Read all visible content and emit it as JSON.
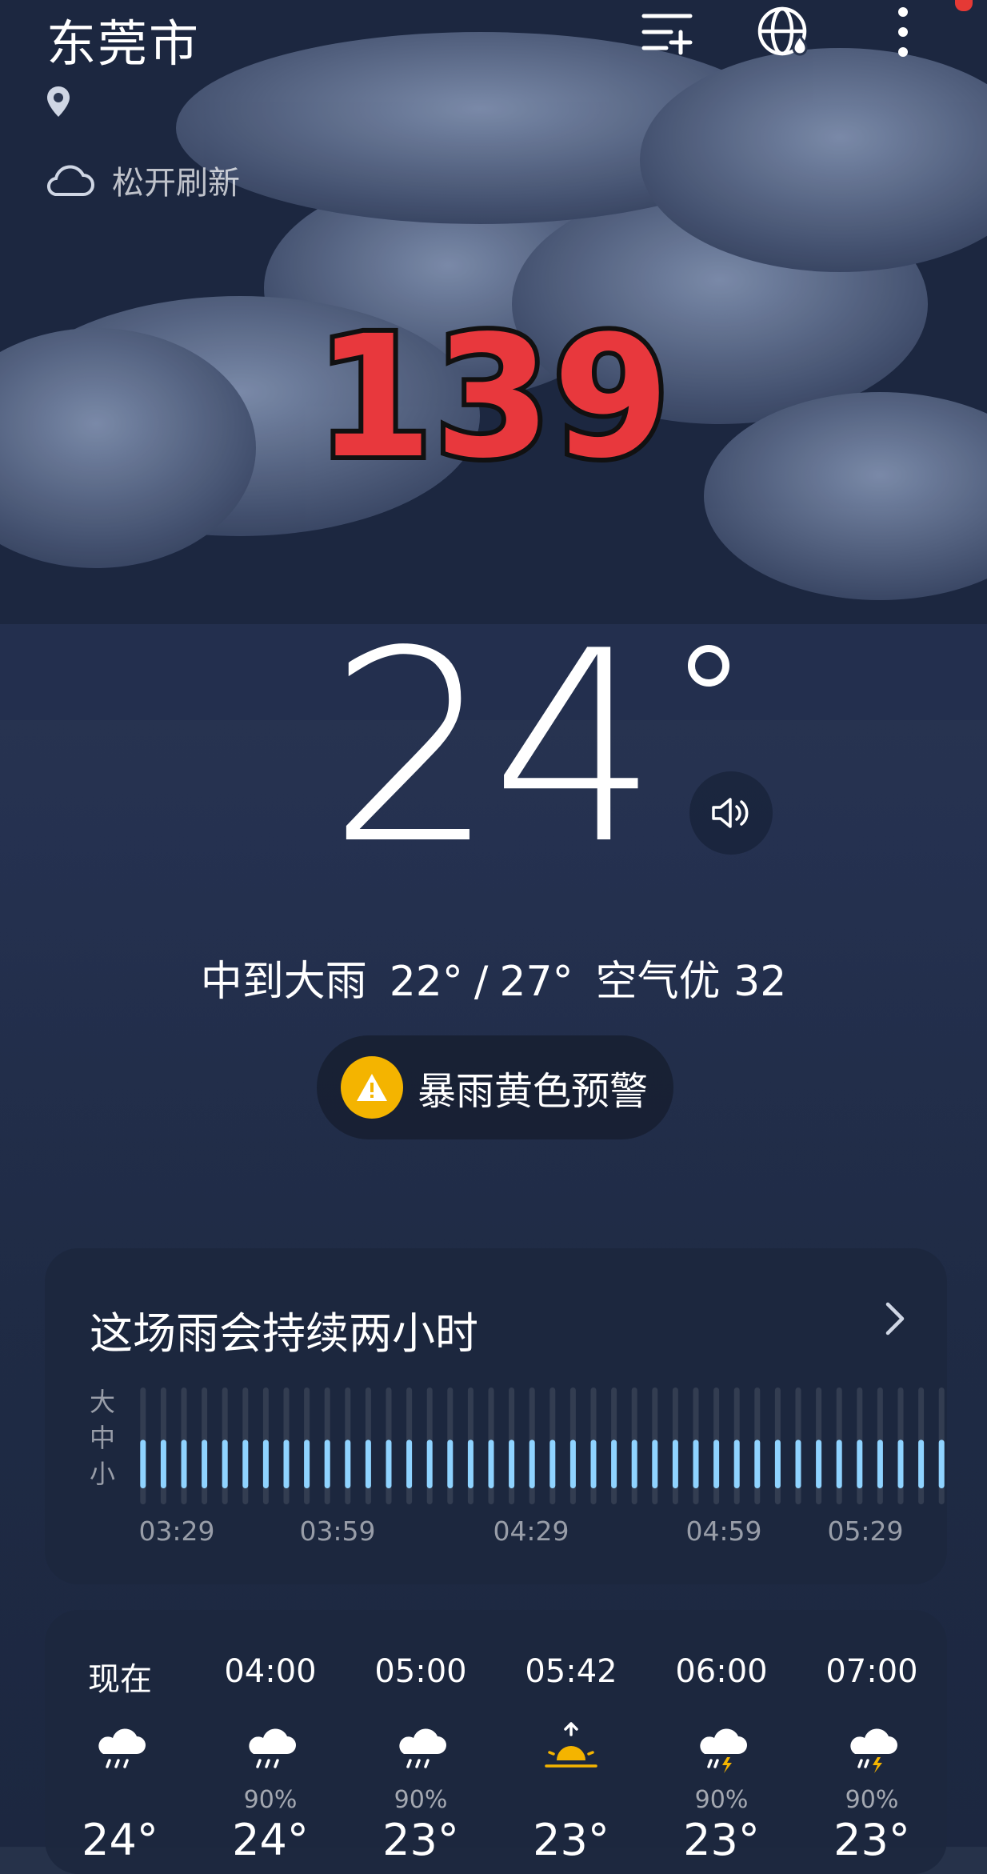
{
  "header": {
    "city": "东莞市",
    "refresh_hint": "松开刷新"
  },
  "overlay_number": "139",
  "current": {
    "temperature": "24",
    "condition": "中到大雨",
    "low": "22°",
    "high": "27°",
    "air_quality": "空气优 32"
  },
  "alert": {
    "label": "暴雨黄色预警",
    "color": "#f4b400"
  },
  "rain_card": {
    "title": "这场雨会持续两小时",
    "scale": [
      "大",
      "中",
      "小"
    ],
    "times": [
      "03:29",
      "03:59",
      "04:29",
      "04:59",
      "05:29"
    ],
    "bar_level": 0.5,
    "bar_color": "#8fd3ff"
  },
  "hourly": [
    {
      "time": "现在",
      "icon": "rain-icon",
      "precip": "",
      "temp": "24°"
    },
    {
      "time": "04:00",
      "icon": "rain-icon",
      "precip": "90%",
      "temp": "24°"
    },
    {
      "time": "05:00",
      "icon": "rain-icon",
      "precip": "90%",
      "temp": "23°"
    },
    {
      "time": "05:42",
      "icon": "sunrise-icon",
      "precip": "",
      "temp": "23°"
    },
    {
      "time": "06:00",
      "icon": "thunderstorm-icon",
      "precip": "90%",
      "temp": "23°"
    },
    {
      "time": "07:00",
      "icon": "thunderstorm-icon",
      "precip": "90%",
      "temp": "23°"
    }
  ]
}
